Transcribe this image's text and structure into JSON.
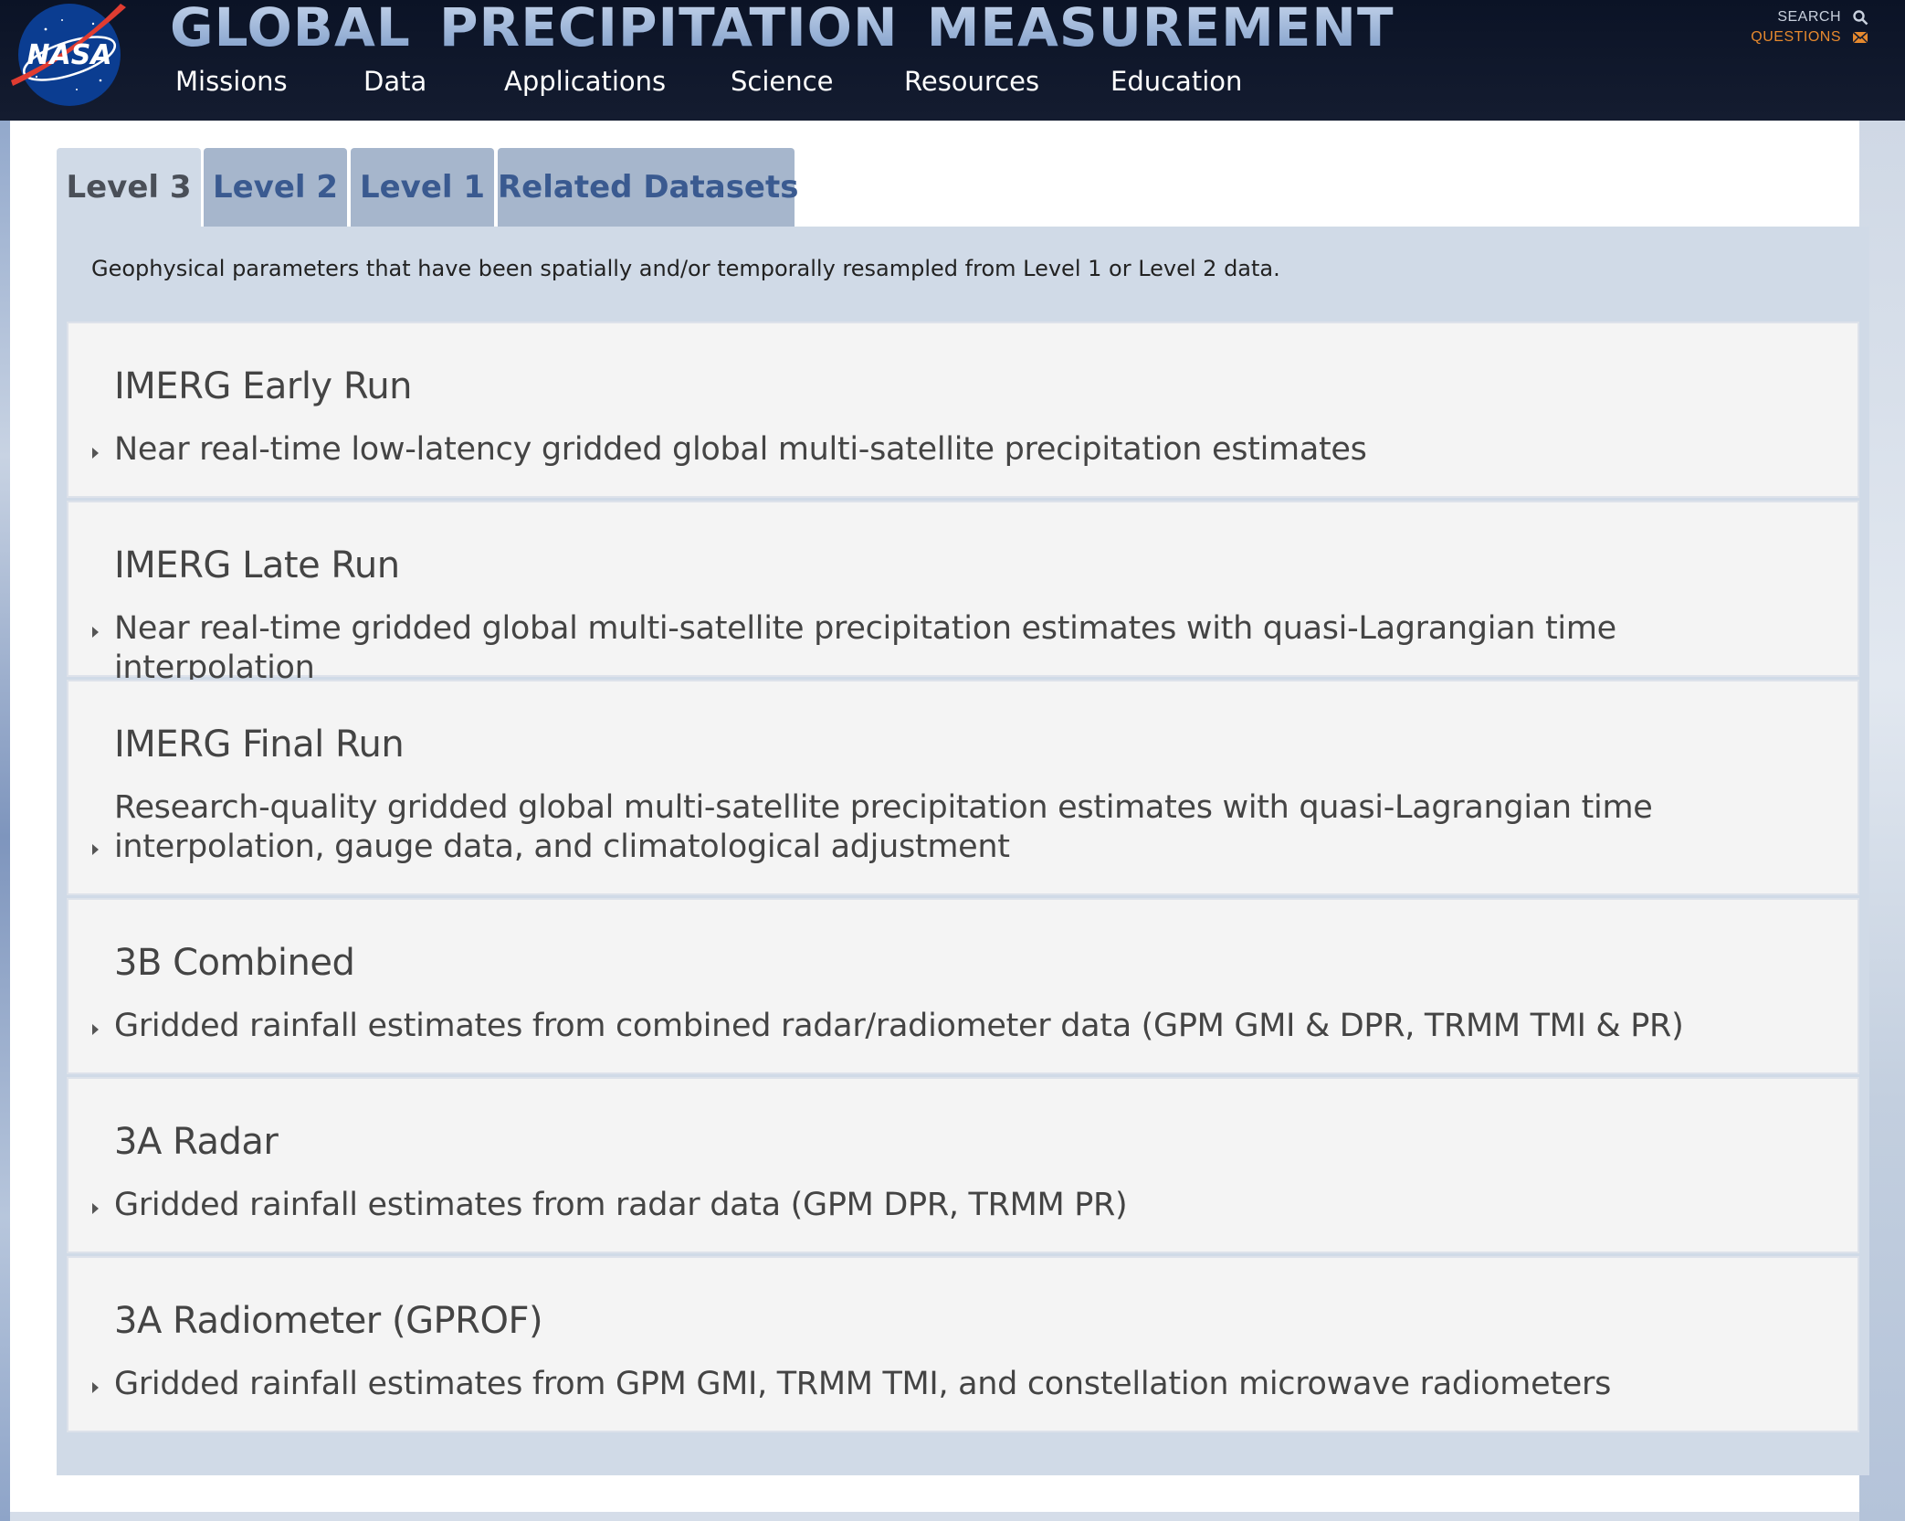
{
  "header": {
    "site_title": "GLOBAL  PRECIPITATION  MEASUREMENT",
    "logo_text": "NASA",
    "nav": [
      {
        "label": "Missions"
      },
      {
        "label": "Data"
      },
      {
        "label": "Applications"
      },
      {
        "label": "Science"
      },
      {
        "label": "Resources"
      },
      {
        "label": "Education"
      }
    ],
    "utility": {
      "search_label": "SEARCH",
      "questions_label": "QUESTIONS"
    }
  },
  "tabs": [
    {
      "label": "Level 3",
      "active": true
    },
    {
      "label": "Level 2",
      "active": false
    },
    {
      "label": "Level 1",
      "active": false
    },
    {
      "label": "Related Datasets",
      "active": false
    }
  ],
  "tab_content": {
    "intro": "Geophysical parameters that have been spatially and/or temporally resampled from Level 1 or Level 2 data.",
    "datasets": [
      {
        "title": "IMERG Early Run",
        "description": "Near real-time low-latency gridded global multi-satellite precipitation estimates"
      },
      {
        "title": "IMERG Late Run",
        "description": "Near real-time gridded global multi-satellite precipitation estimates with quasi-Lagrangian time interpolation"
      },
      {
        "title": "IMERG Final Run",
        "description": "Research-quality gridded global multi-satellite precipitation estimates with quasi-Lagrangian time interpolation, gauge data, and climatological adjustment"
      },
      {
        "title": "3B Combined",
        "description": "Gridded rainfall estimates from combined radar/radiometer data (GPM GMI & DPR, TRMM TMI & PR)"
      },
      {
        "title": "3A Radar",
        "description": "Gridded rainfall estimates from radar data (GPM DPR, TRMM PR)"
      },
      {
        "title": "3A Radiometer (GPROF)",
        "description": "Gridded rainfall estimates from GPM GMI, TRMM TMI, and constellation microwave radiometers"
      }
    ]
  },
  "colors": {
    "header_bg": "#0b1326",
    "title_blue": "#8da9d0",
    "active_tab_bg": "#d0dae7",
    "inactive_tab_bg": "#a6b6cc",
    "inactive_tab_text": "#3a5a90",
    "questions_orange": "#e6892e",
    "card_bg": "#f4f4f4"
  },
  "icons": {
    "search": "search-icon",
    "questions": "mail-icon",
    "expand": "caret-right-icon"
  }
}
